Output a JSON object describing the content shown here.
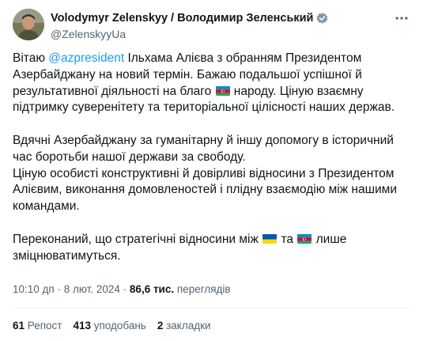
{
  "author": {
    "display_name": "Volodymyr Zelenskyy / Володимир Зеленський",
    "handle": "@ZelenskyyUa",
    "verified_icon": "verified-badge-icon"
  },
  "tweet": {
    "p1_a": "Вітаю ",
    "p1_mention": "@azpresident",
    "p1_b": " Ільхама Алієва з обранням Президентом Азербайджану на новий термін. Бажаю подальшої успішної й результативної діяльності на благо ",
    "p1_c": " народу. Ціную взаємну підтримку суверенітету та територіальної цілісності наших держав.",
    "p2": "Вдячні Азербайджану за гуманітарну й іншу допомогу в історичний час боротьби нашої держави за свободу.",
    "p3": "Ціную особисті конструктивні й довірливі відносини з Президентом Алієвим, виконання домовленостей і плідну взаємодію між нашими командами.",
    "p4_a": "Переконаний, що стратегічні відносини між ",
    "p4_b": " та ",
    "p4_c": " лише зміцнюватимуться.",
    "flags": [
      "azerbaijan-flag-icon",
      "ukraine-flag-icon",
      "azerbaijan-flag-icon"
    ]
  },
  "meta": {
    "time": "10:10 дп",
    "sep": " · ",
    "date": "8 лют. 2024",
    "views_count": "86,6 тис.",
    "views_label": " переглядів"
  },
  "stats": {
    "reposts_count": "61",
    "reposts_label": " Репост",
    "likes_count": "413",
    "likes_label": " уподобань",
    "bookmarks_count": "2",
    "bookmarks_label": " закладки"
  },
  "more_icon": "more-horizontal-icon",
  "colors": {
    "accent": "#1d9bf0",
    "text": "#0f1419",
    "secondary": "#536471",
    "divider": "#eff3f4",
    "ukraine_blue": "#0057b7",
    "ukraine_yellow": "#ffd700",
    "az_blue": "#0092bc",
    "az_red": "#e4002b",
    "az_green": "#00af66"
  }
}
